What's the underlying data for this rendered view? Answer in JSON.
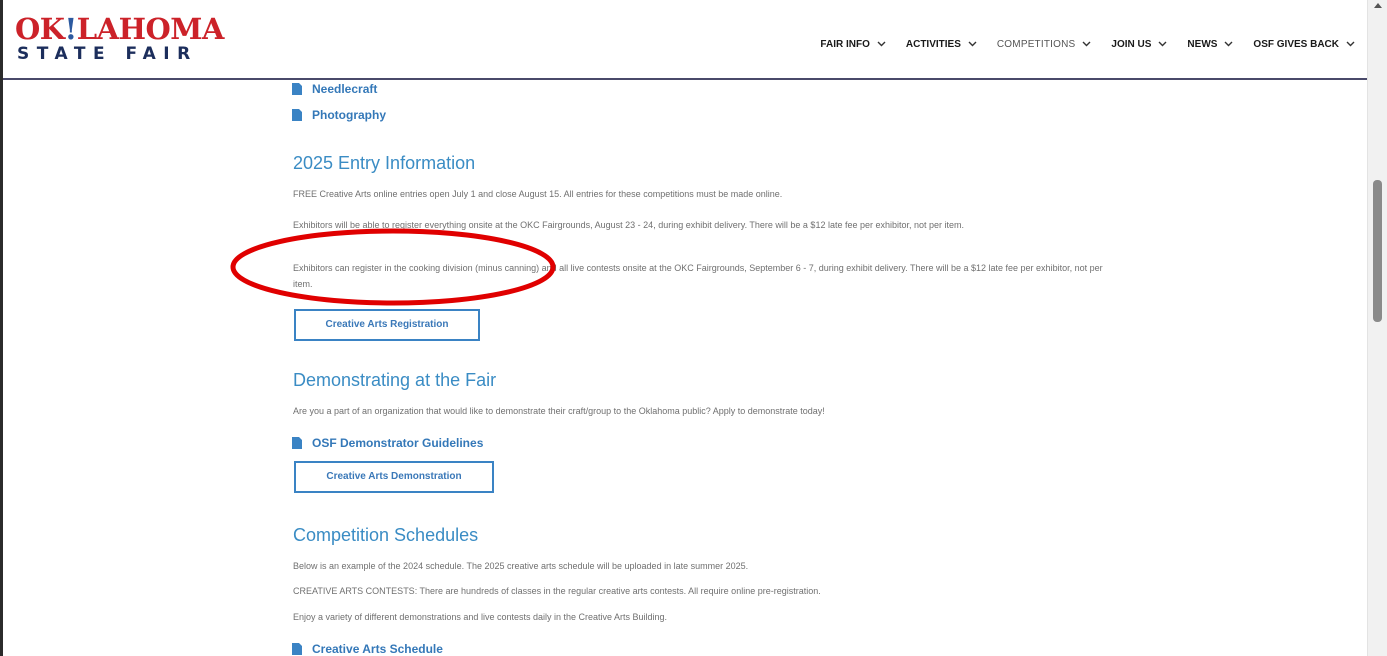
{
  "header": {
    "logo_top_red_a": "OK",
    "logo_top_blue": "!",
    "logo_top_red_b": "LAHOMA",
    "logo_bottom": "STATE FAIR",
    "nav": [
      {
        "label": "FAIR INFO"
      },
      {
        "label": "ACTIVITIES"
      },
      {
        "label": "COMPETITIONS"
      },
      {
        "label": "JOIN US"
      },
      {
        "label": "NEWS"
      },
      {
        "label": "OSF GIVES BACK"
      }
    ]
  },
  "downloads_top": [
    {
      "label": "Needlecraft",
      "icon": "pdf-icon"
    },
    {
      "label": "Photography",
      "icon": "pdf-icon"
    }
  ],
  "entry": {
    "heading": "2025 Entry Information",
    "p1": "FREE Creative Arts online entries open July 1 and close August 15. All entries for these competitions must be made online.",
    "p2": "Exhibitors will be able to register everything onsite at the OKC Fairgrounds, August 23 - 24, during exhibit delivery. There will be a $12 late fee per exhibitor, not per item.",
    "p3": "Exhibitors can register in the cooking division (minus canning) and all live contests onsite at the OKC Fairgrounds, September 6 - 7, during exhibit delivery. There will be a $12 late fee per exhibitor, not per item.",
    "button": "Creative Arts Registration"
  },
  "demo": {
    "heading": "Demonstrating at the Fair",
    "p1": "Are you a part of an organization that would like to demonstrate their craft/group to the Oklahoma public? Apply to demonstrate today!",
    "link": "OSF Demonstrator Guidelines",
    "button": "Creative Arts Demonstration"
  },
  "schedules": {
    "heading": "Competition Schedules",
    "p1": "Below is an example of the 2024 schedule. The 2025 creative arts schedule will be uploaded in late summer 2025.",
    "p2": "CREATIVE ARTS CONTESTS: There are hundreds of classes in the regular creative arts contests. All require online pre-registration.",
    "p3": "Enjoy a variety of different demonstrations and live contests daily in the Creative Arts Building.",
    "link": "Creative Arts Schedule"
  },
  "colors": {
    "accent_blue": "#3a83c4",
    "logo_red": "#cc2229",
    "logo_navy": "#1c2e5c",
    "annotation_red": "#e00000"
  }
}
